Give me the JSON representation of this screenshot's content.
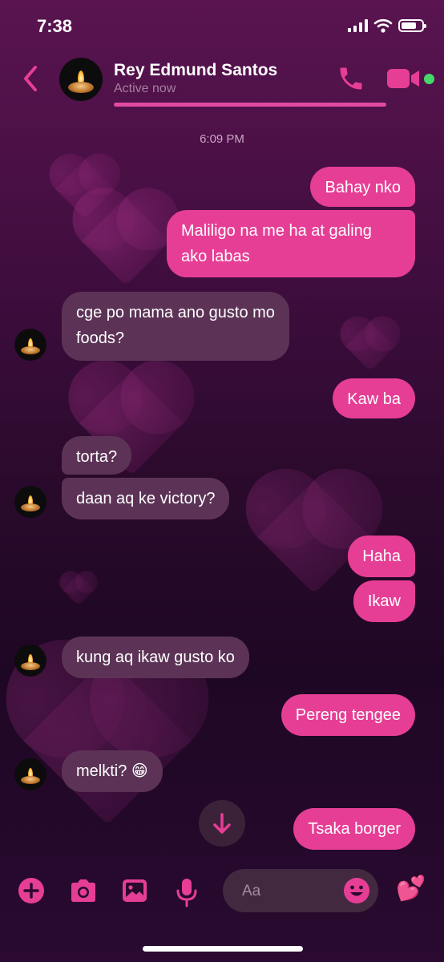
{
  "status_bar": {
    "time": "7:38"
  },
  "header": {
    "contact_name": "Rey Edmund Santos",
    "status": "Active now"
  },
  "timestamp": "6:09 PM",
  "messages": [
    {
      "dir": "out",
      "text": "Bahay nko"
    },
    {
      "dir": "out",
      "text": "Maliligo na me ha at galing ako labas"
    },
    {
      "dir": "in",
      "text": "cge po mama ano gusto mo foods?"
    },
    {
      "dir": "out",
      "text": "Kaw ba"
    },
    {
      "dir": "in",
      "text": "torta?"
    },
    {
      "dir": "in",
      "text": "daan aq ke victory?"
    },
    {
      "dir": "out",
      "text": "Haha"
    },
    {
      "dir": "out",
      "text": "Ikaw"
    },
    {
      "dir": "in",
      "text": "kung aq ikaw gusto ko"
    },
    {
      "dir": "out",
      "text": "Pereng tengee"
    },
    {
      "dir": "in",
      "text": "melkti? 😁"
    },
    {
      "dir": "out",
      "text": "Tsaka borger"
    }
  ],
  "composer": {
    "placeholder": "Aa",
    "quick_reaction": "💕"
  },
  "colors": {
    "accent": "#e63e95",
    "incoming_bubble": "#5c3356",
    "online": "#45d96a"
  }
}
